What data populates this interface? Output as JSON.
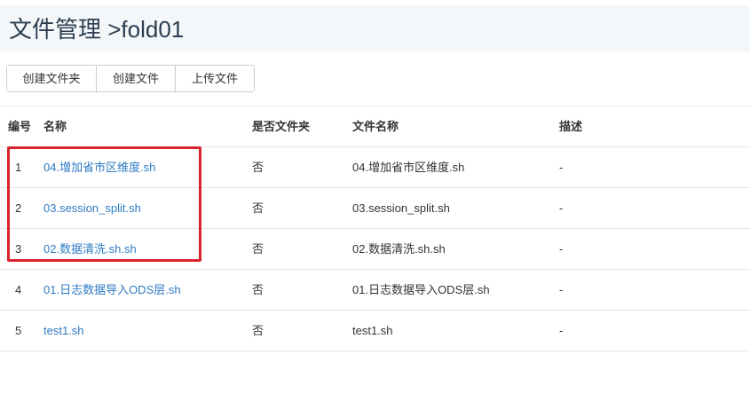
{
  "header": {
    "title": "文件管理 >fold01"
  },
  "toolbar": {
    "create_folder": "创建文件夹",
    "create_file": "创建文件",
    "upload_file": "上传文件"
  },
  "table": {
    "columns": [
      "编号",
      "名称",
      "是否文件夹",
      "文件名称",
      "描述"
    ],
    "rows": [
      {
        "no": "1",
        "name": "04.增加省市区维度.sh",
        "is_folder": "否",
        "file_name": "04.增加省市区维度.sh",
        "desc": "-"
      },
      {
        "no": "2",
        "name": "03.session_split.sh",
        "is_folder": "否",
        "file_name": "03.session_split.sh",
        "desc": "-"
      },
      {
        "no": "3",
        "name": "02.数据清洗.sh.sh",
        "is_folder": "否",
        "file_name": "02.数据清洗.sh.sh",
        "desc": "-"
      },
      {
        "no": "4",
        "name": "01.日志数据导入ODS层.sh",
        "is_folder": "否",
        "file_name": "01.日志数据导入ODS层.sh",
        "desc": "-"
      },
      {
        "no": "5",
        "name": "test1.sh",
        "is_folder": "否",
        "file_name": "test1.sh",
        "desc": "-"
      }
    ]
  },
  "colors": {
    "link": "#2f7bc4",
    "highlight": "#d9232d",
    "header_bg": "#f4f7fa"
  }
}
